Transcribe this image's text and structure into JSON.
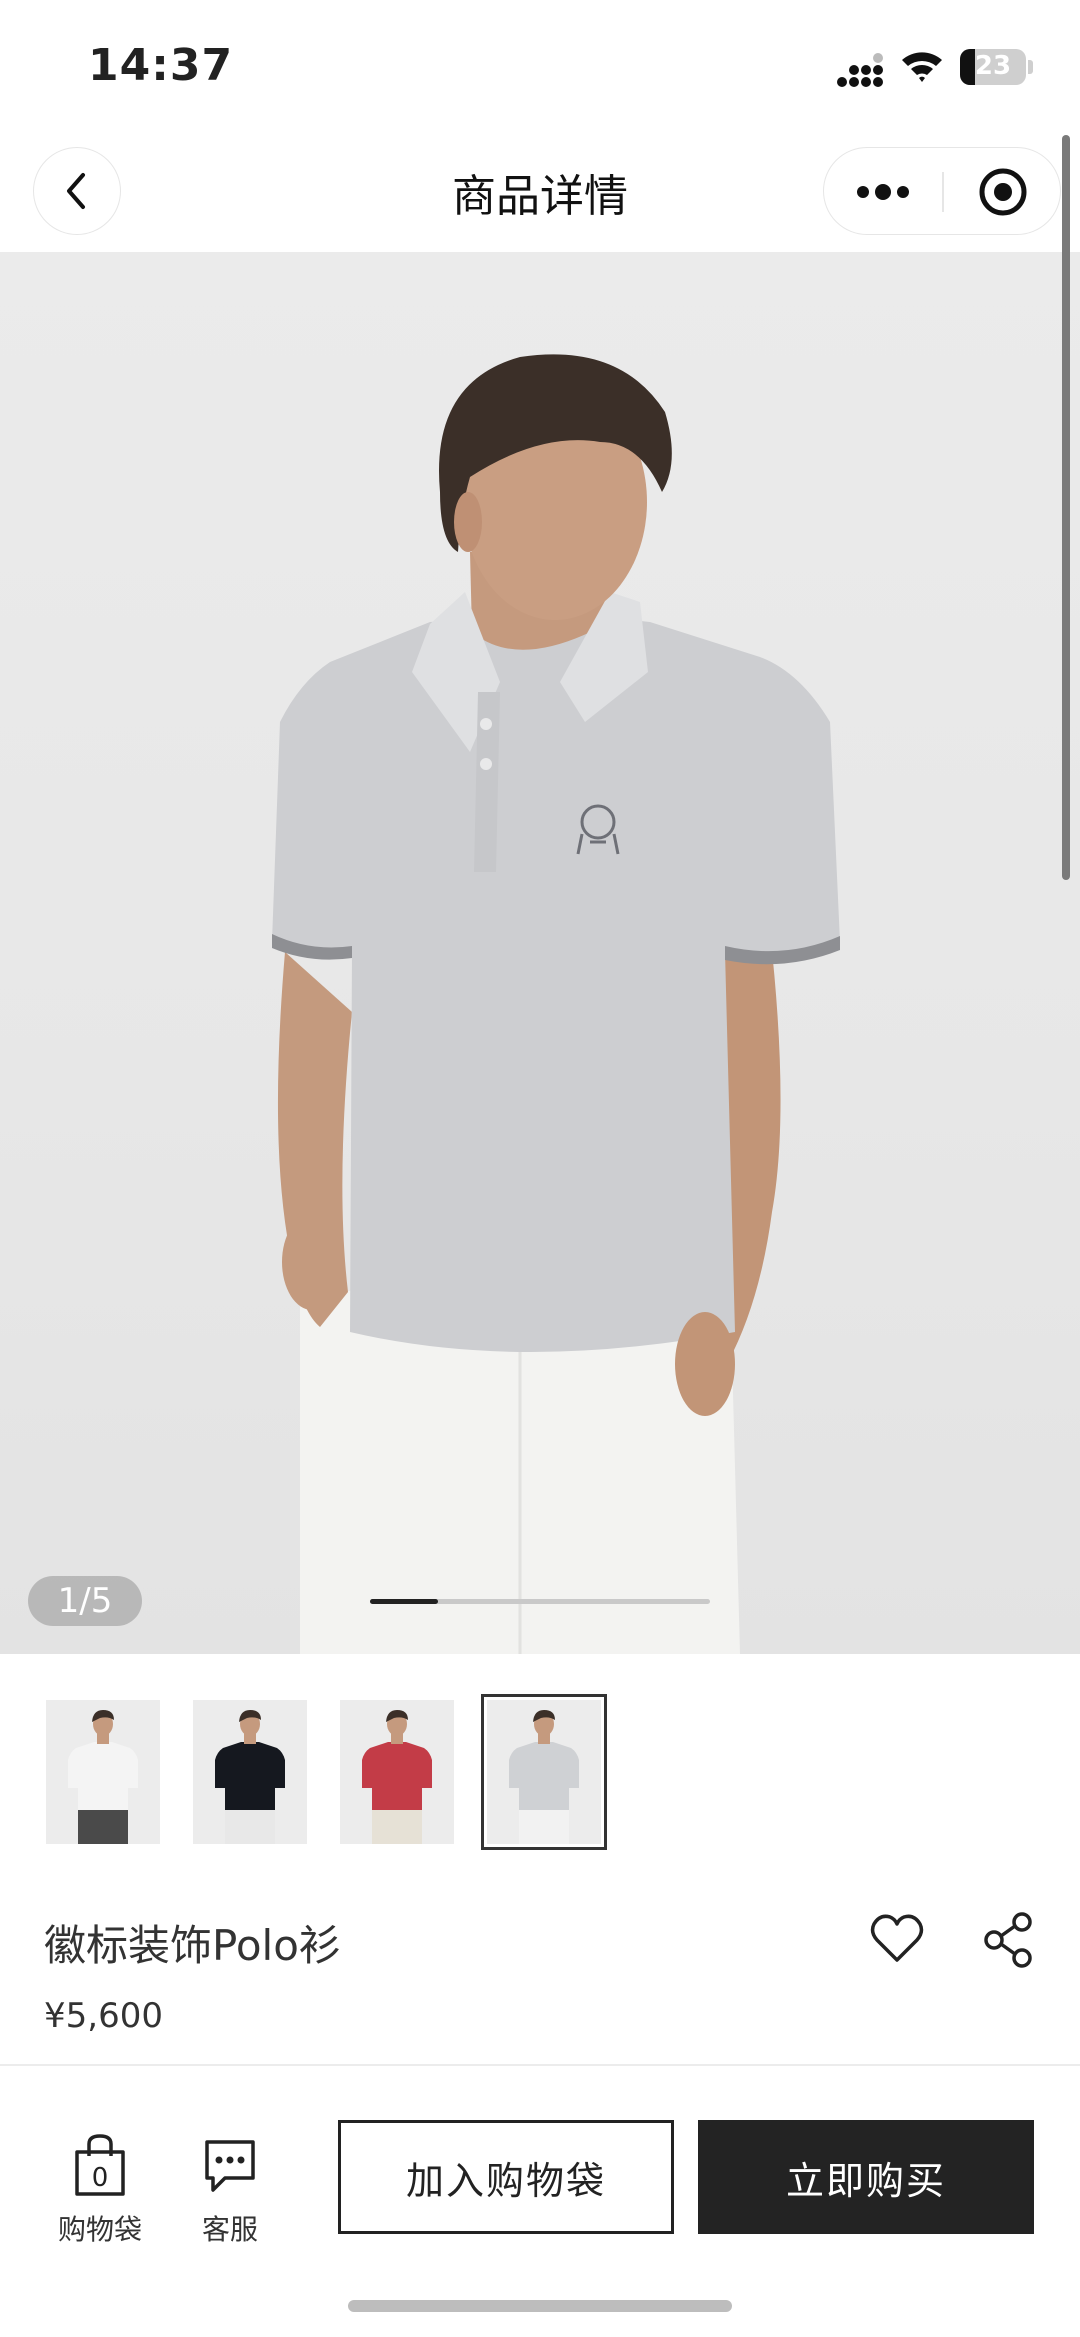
{
  "status_bar": {
    "time": "14:37",
    "battery_level": "23",
    "battery_fraction": 0.23
  },
  "nav": {
    "title": "商品详情"
  },
  "gallery": {
    "counter": "1/5",
    "current_index": 1,
    "total": 5,
    "progress_fraction": 0.2,
    "thumbnails": [
      {
        "label": "white polo",
        "shirt_color": "#f4f4f4",
        "pants_color": "#4a4a4a",
        "selected": false
      },
      {
        "label": "navy polo",
        "shirt_color": "#15181f",
        "pants_color": "#e8e8e8",
        "selected": false
      },
      {
        "label": "red polo",
        "shirt_color": "#c33c47",
        "pants_color": "#e6e1d6",
        "selected": false
      },
      {
        "label": "light grey polo",
        "shirt_color": "#cfd1d4",
        "pants_color": "#f2f2f2",
        "selected": true
      }
    ]
  },
  "product": {
    "name": "徽标装饰Polo衫",
    "price": "¥5,600"
  },
  "bottom_bar": {
    "bag_label": "购物袋",
    "bag_count": "0",
    "service_label": "客服",
    "add_to_bag": "加入购物袋",
    "buy_now": "立即购买"
  },
  "colors": {
    "primary_dark": "#232323",
    "shirt_grey": "#cdced1",
    "background_grey": "#e9e9e9"
  }
}
